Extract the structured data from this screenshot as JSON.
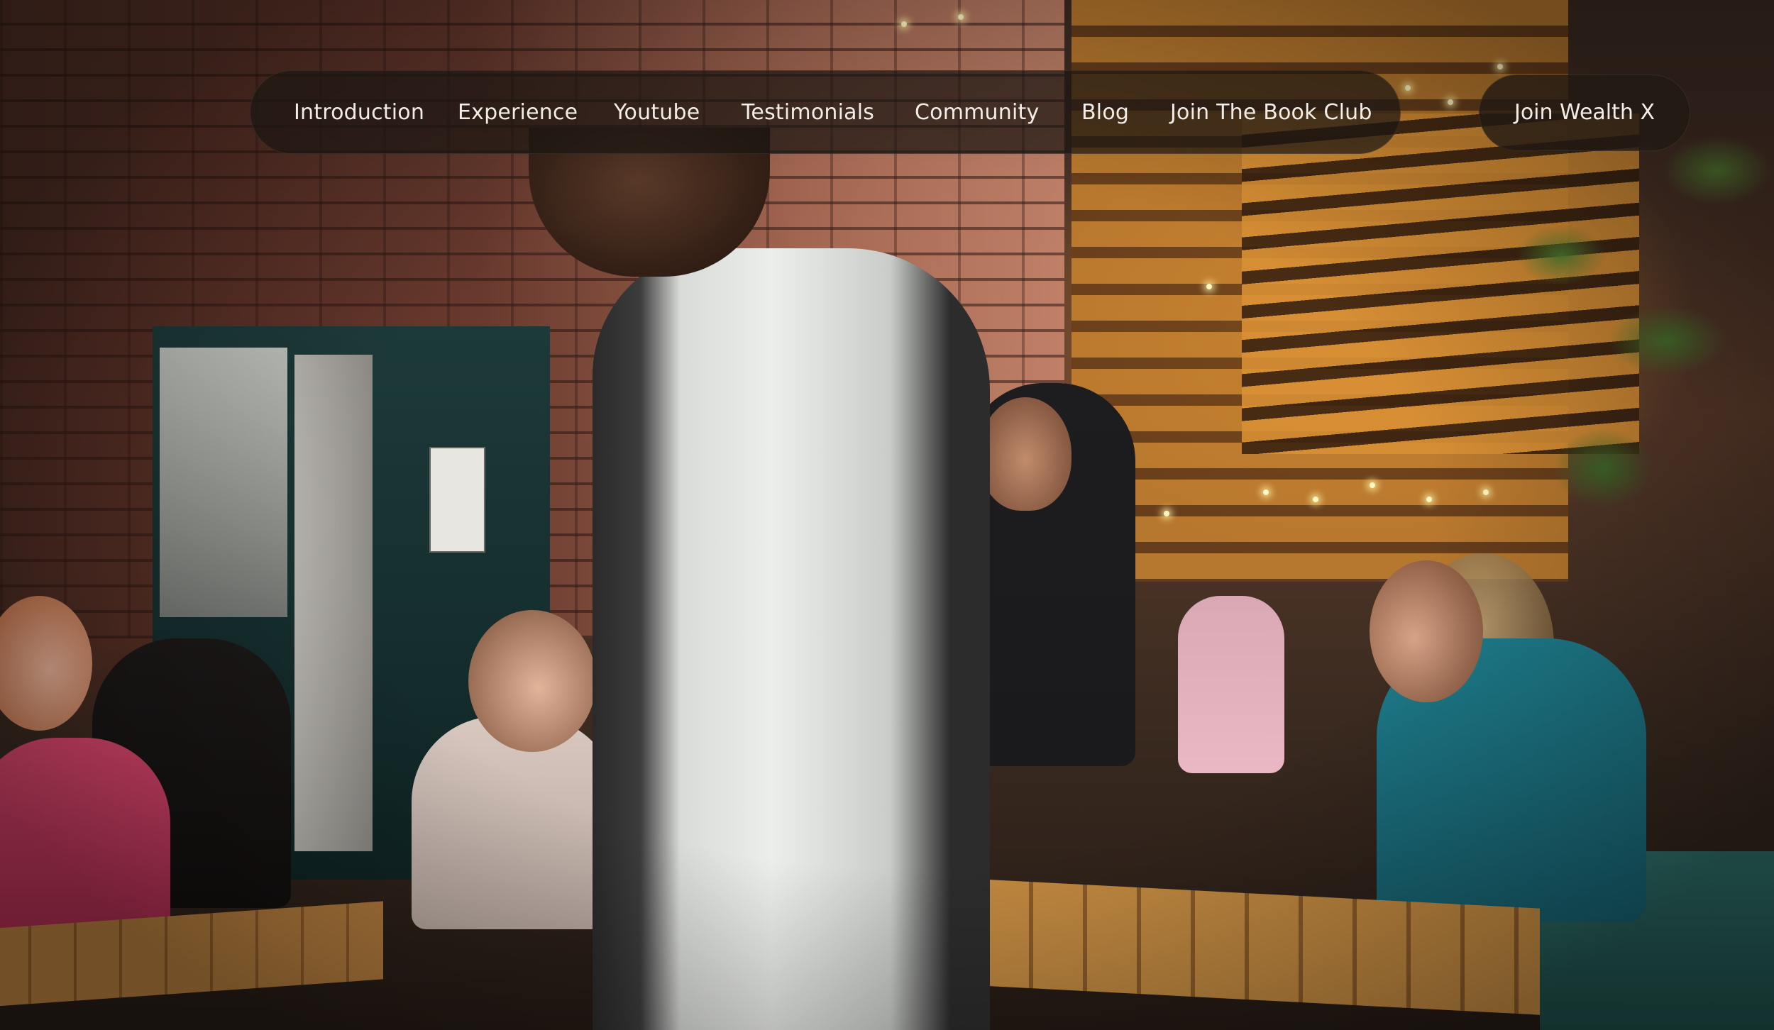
{
  "nav": {
    "items": [
      {
        "label": "Introduction"
      },
      {
        "label": "Experience"
      },
      {
        "label": "Youtube"
      },
      {
        "label": "Testimonials"
      },
      {
        "label": "Community"
      },
      {
        "label": "Blog"
      },
      {
        "label": "Join The Book Club"
      }
    ],
    "cta_label": "Join Wealth X"
  },
  "colors": {
    "nav_background": "#1c1612",
    "nav_text": "#f2ede6"
  },
  "hero": {
    "media": "background-photo-cafe-scene"
  }
}
